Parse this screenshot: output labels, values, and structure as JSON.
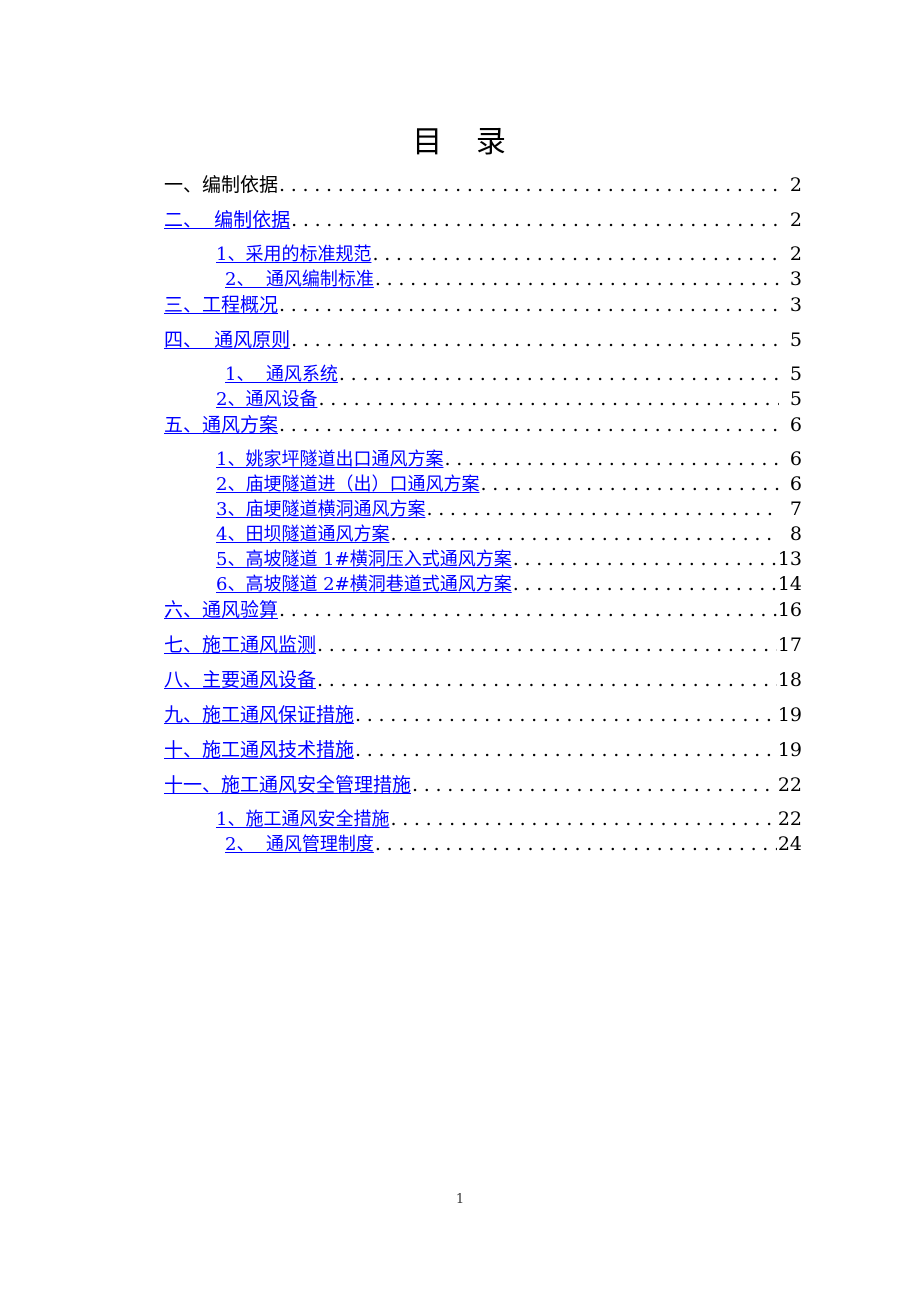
{
  "document": {
    "title": "目　录",
    "page_number": "1",
    "link_color": "#0000FF",
    "text_color": "#000000"
  },
  "toc": {
    "entries": [
      {
        "label": "一、编制依据",
        "page": "2",
        "level": 1,
        "style": "plain"
      },
      {
        "label": "二、  编制依据",
        "page": "2",
        "level": 1,
        "style": "link"
      },
      {
        "label": "1、采用的标准规范",
        "page": "2",
        "level": 2,
        "style": "link"
      },
      {
        "label": "2、  通风编制标准",
        "page": "3",
        "level": 2,
        "style": "link",
        "deep": true
      },
      {
        "label": "三、工程概况",
        "page": "3",
        "level": 1,
        "style": "link"
      },
      {
        "label": "四、  通风原则",
        "page": "5",
        "level": 1,
        "style": "link"
      },
      {
        "label": "1、  通风系统",
        "page": "5",
        "level": 2,
        "style": "link",
        "deep": true
      },
      {
        "label": "2、通风设备",
        "page": "5",
        "level": 2,
        "style": "link"
      },
      {
        "label": "五、通风方案",
        "page": "6",
        "level": 1,
        "style": "link"
      },
      {
        "label": "1、姚家坪隧道出口通风方案",
        "page": "6",
        "level": 2,
        "style": "link"
      },
      {
        "label": "2、庙埂隧道进（出）口通风方案",
        "page": "6",
        "level": 2,
        "style": "link"
      },
      {
        "label": "3、庙埂隧道横洞通风方案",
        "page": "7",
        "level": 2,
        "style": "link"
      },
      {
        "label": "4、田坝隧道通风方案",
        "page": "8",
        "level": 2,
        "style": "link"
      },
      {
        "label": "5、高坡隧道 1#横洞压入式通风方案",
        "page": "13",
        "level": 2,
        "style": "link"
      },
      {
        "label": "6、高坡隧道 2#横洞巷道式通风方案",
        "page": "14",
        "level": 2,
        "style": "link"
      },
      {
        "label": "六、通风验算",
        "page": "16",
        "level": 1,
        "style": "link"
      },
      {
        "label": "七、施工通风监测",
        "page": "17",
        "level": 1,
        "style": "link"
      },
      {
        "label": "八、主要通风设备",
        "page": "18",
        "level": 1,
        "style": "link"
      },
      {
        "label": "九、施工通风保证措施",
        "page": "19",
        "level": 1,
        "style": "link"
      },
      {
        "label": "十、施工通风技术措施",
        "page": "19",
        "level": 1,
        "style": "link"
      },
      {
        "label": "十一、施工通风安全管理措施",
        "page": "22",
        "level": 1,
        "style": "link"
      },
      {
        "label": "1、施工通风安全措施",
        "page": "22",
        "level": 2,
        "style": "link"
      },
      {
        "label": "2、  通风管理制度",
        "page": "24",
        "level": 2,
        "style": "link",
        "deep": true
      }
    ]
  }
}
